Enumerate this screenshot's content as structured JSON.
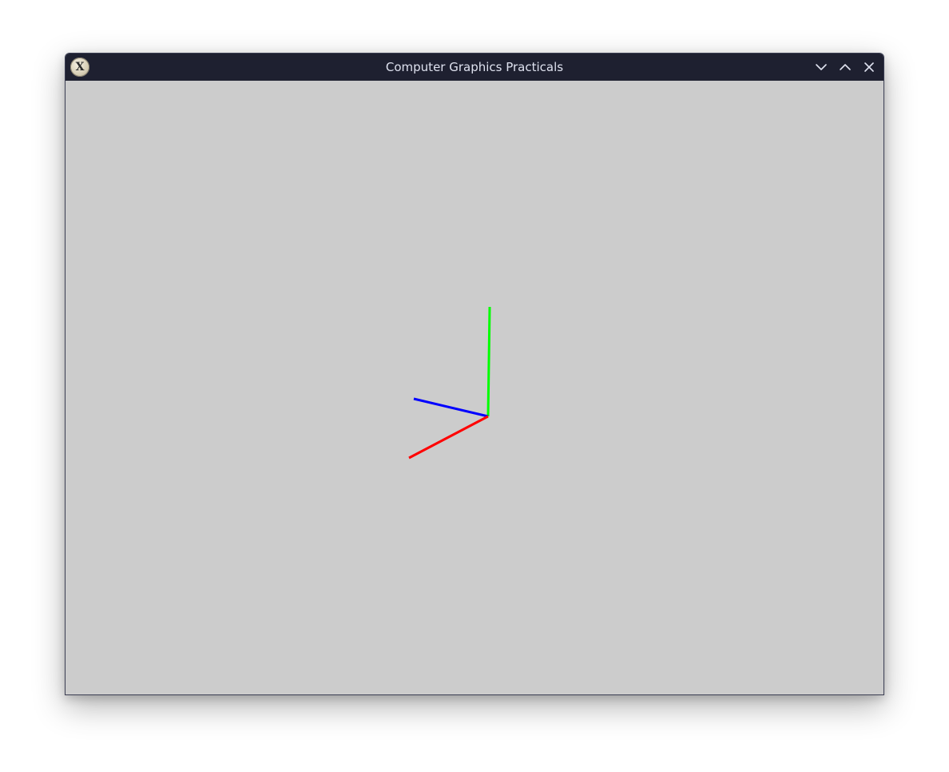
{
  "window": {
    "title": "Computer Graphics Practicals"
  },
  "titlebar": {
    "app_icon": "x-window-system-icon",
    "controls": [
      "minimize-icon",
      "maximize-icon",
      "close-icon"
    ]
  },
  "canvas": {
    "background_color": "#cccccc",
    "axes": [
      {
        "name": "x-axis",
        "color": "#ff0000"
      },
      {
        "name": "y-axis",
        "color": "#00ff00"
      },
      {
        "name": "z-axis",
        "color": "#0000ff"
      }
    ]
  },
  "colors": {
    "titlebar": "#1e2030",
    "title_text": "#dfe2ef"
  }
}
